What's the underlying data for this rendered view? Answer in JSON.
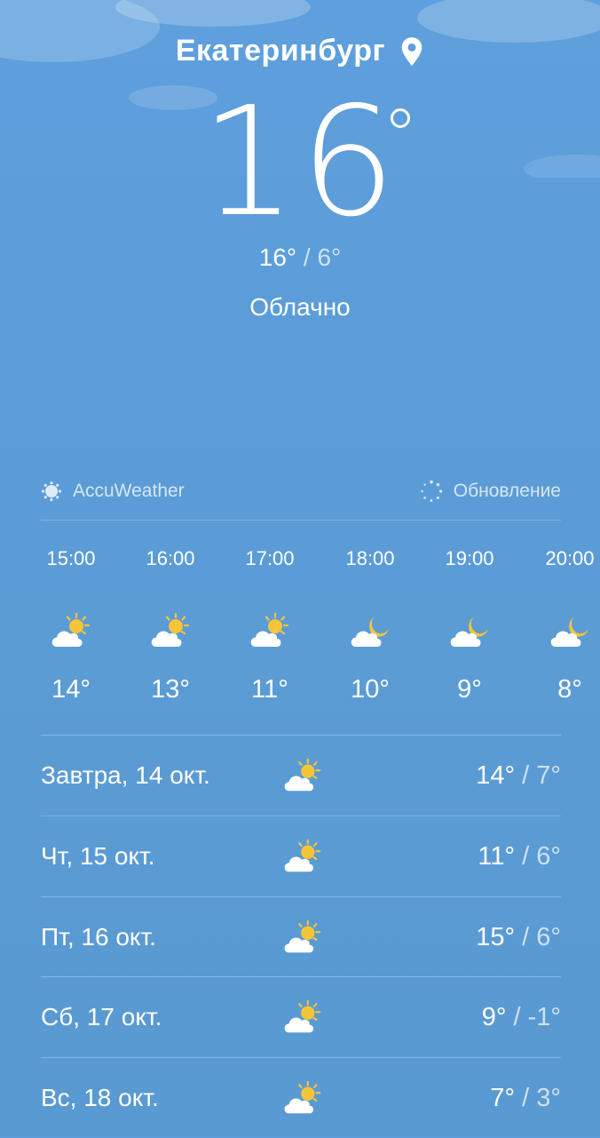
{
  "location": {
    "city": "Екатеринбург",
    "pin_icon": "location-pin-icon"
  },
  "current": {
    "temperature": "16",
    "high": "16°",
    "low": "6°",
    "separator": " / ",
    "condition": "Облачно"
  },
  "source": {
    "provider": "AccuWeather",
    "provider_icon": "accuweather-sun-icon",
    "update_label": "Обновление",
    "update_icon": "refresh-spinner-icon"
  },
  "hourly": [
    {
      "time": "15:00",
      "icon": "partly-cloudy-day-icon",
      "temp": "14°"
    },
    {
      "time": "16:00",
      "icon": "partly-cloudy-day-icon",
      "temp": "13°"
    },
    {
      "time": "17:00",
      "icon": "partly-cloudy-day-icon",
      "temp": "11°"
    },
    {
      "time": "18:00",
      "icon": "partly-cloudy-night-icon",
      "temp": "10°"
    },
    {
      "time": "19:00",
      "icon": "partly-cloudy-night-icon",
      "temp": "9°"
    },
    {
      "time": "20:00",
      "icon": "partly-cloudy-night-icon",
      "temp": "8°"
    }
  ],
  "daily": [
    {
      "label": "Завтра, 14 окт.",
      "icon": "partly-cloudy-day-icon",
      "high": "14°",
      "low": "7°"
    },
    {
      "label": "Чт, 15 окт.",
      "icon": "partly-cloudy-day-icon",
      "high": "11°",
      "low": "6°"
    },
    {
      "label": "Пт, 16 окт.",
      "icon": "partly-cloudy-day-icon",
      "high": "15°",
      "low": "6°"
    },
    {
      "label": "Сб, 17 окт.",
      "icon": "partly-cloudy-day-icon",
      "high": "9°",
      "low": "-1°"
    },
    {
      "label": "Вс, 18 окт.",
      "icon": "partly-cloudy-day-icon",
      "high": "7°",
      "low": "3°"
    }
  ],
  "colors": {
    "sky": "#5b9cd6",
    "sun": "#f7c53a",
    "cloud": "#ffffff"
  }
}
